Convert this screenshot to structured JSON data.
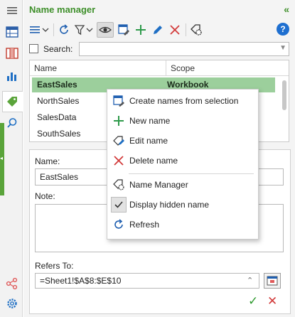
{
  "panel": {
    "title": "Name manager",
    "collapse_glyph": "«"
  },
  "sidebar": {
    "icons": [
      "menu-icon",
      "table-icon",
      "columns-icon",
      "chart-icon",
      "tag-icon",
      "search-icon",
      "share-icon",
      "settings-icon"
    ]
  },
  "toolbar": {
    "help_label": "?"
  },
  "search": {
    "label": "Search:",
    "value": ""
  },
  "list": {
    "columns": [
      "Name",
      "Scope"
    ],
    "rows": [
      {
        "name": "EastSales",
        "scope": "Workbook"
      },
      {
        "name": "NorthSales",
        "scope": ""
      },
      {
        "name": "SalesData",
        "scope": ""
      },
      {
        "name": "SouthSales",
        "scope": ""
      }
    ],
    "selected_index": 0
  },
  "detail": {
    "name_label": "Name:",
    "name_value": "EastSales",
    "note_label": "Note:",
    "note_value": "",
    "refers_label": "Refers To:",
    "refers_value": "=Sheet1!$A$8:$E$10"
  },
  "context_menu": {
    "items": [
      {
        "label": "Create names from selection",
        "icon": "create-from-selection-icon"
      },
      {
        "label": "New name",
        "icon": "plus-icon"
      },
      {
        "label": "Edit name",
        "icon": "edit-tag-icon"
      },
      {
        "label": "Delete name",
        "icon": "x-icon"
      },
      {
        "label": "Name Manager",
        "icon": "name-manager-icon"
      },
      {
        "label": "Display hidden name",
        "icon": "check-icon",
        "checked": true
      },
      {
        "label": "Refresh",
        "icon": "refresh-icon"
      }
    ]
  },
  "colors": {
    "accent_green": "#3e8f2a",
    "selection_green": "#9ccf9c",
    "delete_red": "#d23a3a",
    "help_blue": "#1e6fd0"
  }
}
